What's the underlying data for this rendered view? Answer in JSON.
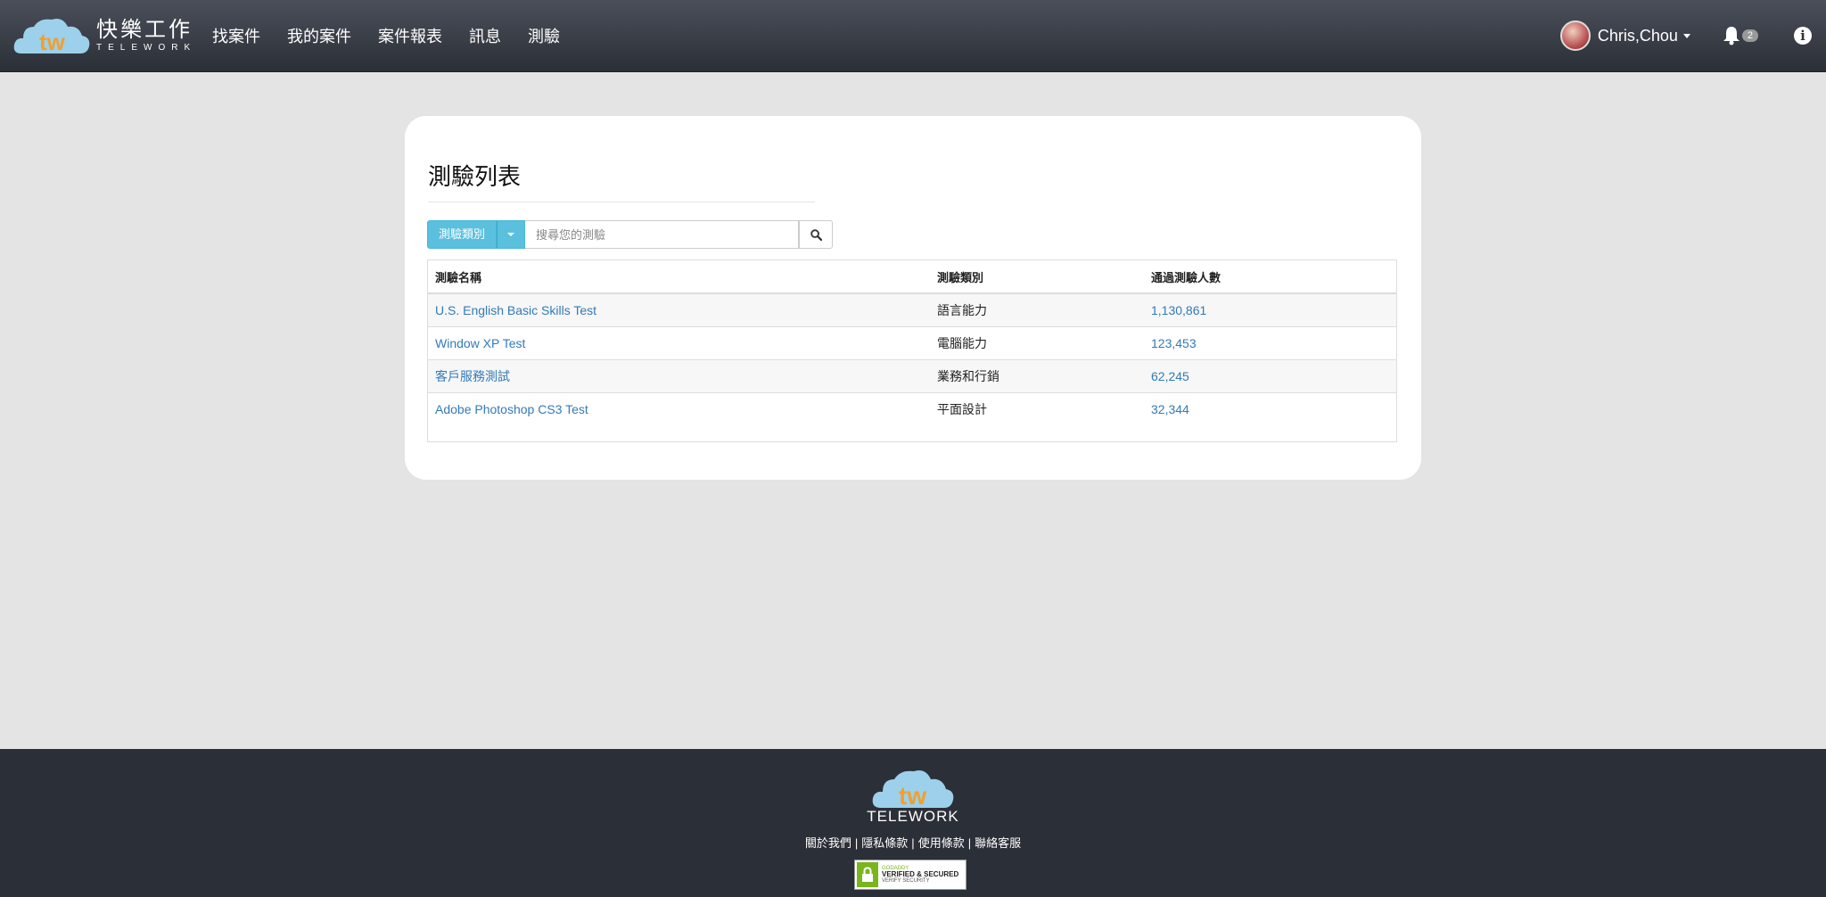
{
  "brand": {
    "name_cn": "快樂工作",
    "name_en": "TELEWORK",
    "logo_letters": "tw"
  },
  "nav": {
    "items": [
      "找案件",
      "我的案件",
      "案件報表",
      "訊息",
      "測驗"
    ]
  },
  "user": {
    "name": "Chris,Chou",
    "notification_count": "2"
  },
  "icons": {
    "bell": "bell-icon",
    "info": "info-icon",
    "search": "search-icon",
    "caret": "caret-down-icon"
  },
  "page": {
    "title": "測驗列表",
    "category_button": "測驗類別",
    "search_placeholder": "搜尋您的測驗"
  },
  "table": {
    "headers": [
      "測驗名稱",
      "測驗類別",
      "通過測驗人數"
    ],
    "rows": [
      {
        "name": "U.S. English Basic Skills Test",
        "category": "語言能力",
        "passed": "1,130,861"
      },
      {
        "name": "Window XP Test",
        "category": "電腦能力",
        "passed": "123,453"
      },
      {
        "name": "客戶服務測試",
        "category": "業務和行銷",
        "passed": "62,245"
      },
      {
        "name": "Adobe Photoshop CS3 Test",
        "category": "平面設計",
        "passed": "32,344"
      }
    ]
  },
  "footer": {
    "brand": "TELEWORK",
    "links": [
      "關於我們",
      "隱私條款",
      "使用條款",
      "聯絡客服"
    ],
    "separator": "|",
    "seal": {
      "line1": "GODADDY",
      "line2": "VERIFIED & SECURED",
      "line3": "VERIFY SECURITY"
    }
  },
  "colors": {
    "accent": "#5bc0de",
    "link": "#337ab7",
    "nav_bg": "#2b2f37",
    "logo_orange": "#f0a030",
    "logo_blue": "#9dd0ea"
  }
}
